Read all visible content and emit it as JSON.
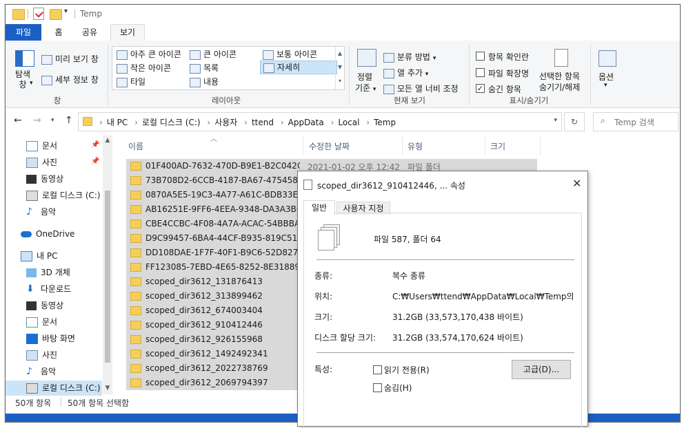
{
  "window": {
    "title": "Temp"
  },
  "tabs": [
    {
      "label": "파일"
    },
    {
      "label": "홈"
    },
    {
      "label": "공유"
    },
    {
      "label": "보기"
    }
  ],
  "ribbon": {
    "pane": {
      "nav_pane_label": "탐색\n창",
      "preview_label": "미리 보기 창",
      "details_label": "세부 정보 창",
      "group_label": "창"
    },
    "layout": {
      "items": [
        {
          "label": "아주 큰 아이콘"
        },
        {
          "label": "큰 아이콘"
        },
        {
          "label": "보통 아이콘"
        },
        {
          "label": "작은 아이콘"
        },
        {
          "label": "목록"
        },
        {
          "label": "자세히"
        },
        {
          "label": "타일"
        },
        {
          "label": "내용"
        }
      ],
      "selected": "자세히",
      "group_label": "레이아웃"
    },
    "current_view": {
      "sort_label_1": "정렬",
      "sort_label_2": "기준",
      "group_by_label": "분류 방법",
      "add_columns_label": "열 추가",
      "fit_columns_label": "모든 열 너비 조정",
      "group_label": "현재 보기"
    },
    "show_hide": {
      "item_checkboxes_label": "항목 확인란",
      "file_ext_label": "파일 확장명",
      "hidden_items_label": "숨긴 항목",
      "item_checkboxes_checked": false,
      "file_ext_checked": false,
      "hidden_items_checked": true,
      "hide_selected_label_1": "선택한 항목",
      "hide_selected_label_2": "숨기기/해제",
      "group_label": "표시/숨기기"
    },
    "options_label": "옵션"
  },
  "address": {
    "path": [
      "내 PC",
      "로컬 디스크 (C:)",
      "사용자",
      "ttend",
      "AppData",
      "Local",
      "Temp"
    ],
    "search_placeholder": "Temp 검색"
  },
  "nav": {
    "quick_access": [
      {
        "label": "문서",
        "pinned": true,
        "icon": "document-icon"
      },
      {
        "label": "사진",
        "pinned": true,
        "icon": "pictures-icon"
      },
      {
        "label": "동영상",
        "pinned": false,
        "icon": "video-icon"
      },
      {
        "label": "로컬 디스크 (C:)",
        "pinned": false,
        "icon": "drive-icon"
      },
      {
        "label": "음악",
        "pinned": false,
        "icon": "music-icon"
      }
    ],
    "onedrive": "OneDrive",
    "this_pc": "내 PC",
    "pc_items": [
      {
        "label": "3D 개체",
        "icon": "3d-objects-icon"
      },
      {
        "label": "다운로드",
        "icon": "download-icon"
      },
      {
        "label": "동영상",
        "icon": "video-icon"
      },
      {
        "label": "문서",
        "icon": "document-icon"
      },
      {
        "label": "바탕 화면",
        "icon": "desktop-icon"
      },
      {
        "label": "사진",
        "icon": "pictures-icon"
      },
      {
        "label": "음악",
        "icon": "music-icon"
      },
      {
        "label": "로컬 디스크 (C:)",
        "icon": "drive-icon"
      }
    ]
  },
  "file_list": {
    "columns": [
      "이름",
      "수정한 날짜",
      "유형",
      "크기"
    ],
    "first_row": {
      "date": "2021-01-02 오후 12:42",
      "type": "파일 폴더"
    },
    "rows": [
      "01F400AD-7632-470D-B9E1-B2C042C...",
      "73B708D2-6CCB-4187-BA67-475458A...",
      "0870A5E5-19C3-4A77-A61C-BDB33EF...",
      "AB16251E-9FF6-4EEA-9348-DA3A3B0...",
      "CBE4CCBC-4F08-4A7A-ACAC-54BBBA...",
      "D9C99457-6BA4-44CF-B935-819C513...",
      "DD108DAE-1F7F-40F1-B9C6-52D827D...",
      "FF123085-7EBD-4E65-8252-8E31889F...",
      "scoped_dir3612_131876413",
      "scoped_dir3612_313899462",
      "scoped_dir3612_674003404",
      "scoped_dir3612_910412446",
      "scoped_dir3612_926155968",
      "scoped_dir3612_1492492341",
      "scoped_dir3612_2022738769",
      "scoped_dir3612_2069794397"
    ]
  },
  "status": {
    "item_count": "50개 항목",
    "selected": "50개 항목 선택함"
  },
  "dialog": {
    "title": "scoped_dir3612_910412446, ... 속성",
    "tabs": [
      "일반",
      "사용자 지정"
    ],
    "summary": "파일 587, 폴더 64",
    "type_label": "종류:",
    "type_value": "복수 종류",
    "location_label": "위치:",
    "location_value": "C:₩Users₩ttend₩AppData₩Local₩Temp의 모든",
    "size_label": "크기:",
    "size_value": "31.2GB (33,573,170,438 바이트)",
    "disk_size_label": "디스크 할당 크기:",
    "disk_size_value": "31.2GB (33,574,170,624 바이트)",
    "attributes_label": "특성:",
    "readonly_label": "읽기 전용(R)",
    "hidden_label": "숨김(H)",
    "advanced_button": "고급(D)..."
  }
}
